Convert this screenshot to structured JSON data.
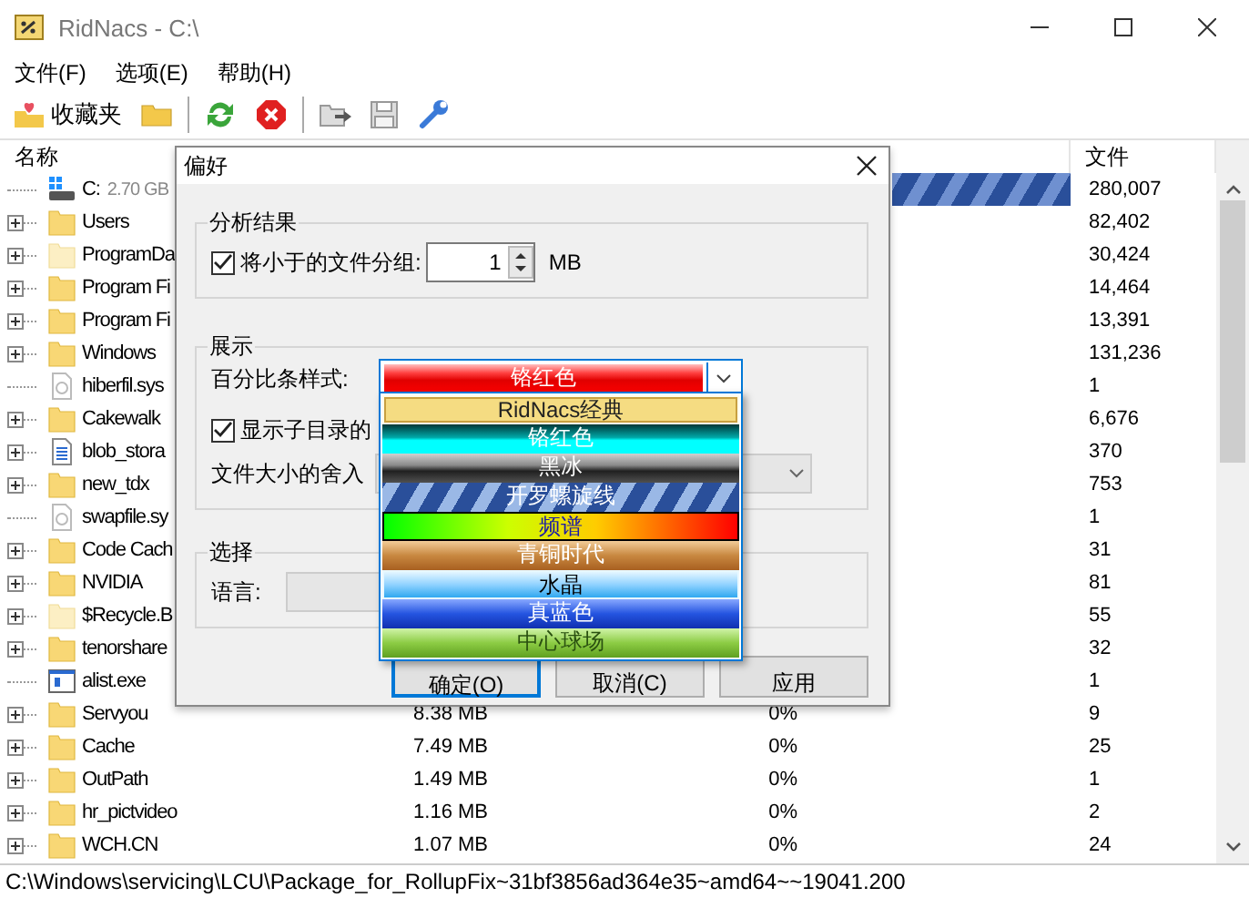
{
  "window": {
    "title": "RidNacs - C:\\"
  },
  "menu": [
    "文件(F)",
    "选项(E)",
    "帮助(H)"
  ],
  "toolbar": [
    {
      "kind": "favorites",
      "label": "收藏夹"
    },
    {
      "kind": "folder"
    },
    {
      "kind": "separator"
    },
    {
      "kind": "refresh"
    },
    {
      "kind": "stop"
    },
    {
      "kind": "separator"
    },
    {
      "kind": "export"
    },
    {
      "kind": "save"
    },
    {
      "kind": "settings"
    }
  ],
  "list": {
    "name_header": "名称",
    "files_header": "文件",
    "rows": [
      {
        "name": "C:",
        "detail": "2.70 GB",
        "kind": "drive",
        "expandable": false,
        "level": 1,
        "files": "280,007"
      },
      {
        "name": "Users",
        "kind": "folder",
        "expandable": true,
        "files": "82,402"
      },
      {
        "name": "ProgramDa",
        "kind": "faded_folder",
        "expandable": true,
        "files": "30,424"
      },
      {
        "name": "Program Fi",
        "kind": "folder",
        "expandable": true,
        "files": "14,464"
      },
      {
        "name": "Program Fi",
        "kind": "folder",
        "expandable": true,
        "files": "13,391"
      },
      {
        "name": "Windows",
        "kind": "folder",
        "expandable": true,
        "files": "131,236"
      },
      {
        "name": "hiberfil.sys",
        "kind": "system_file",
        "expandable": false,
        "files": "1"
      },
      {
        "name": "Cakewalk",
        "kind": "folder",
        "expandable": true,
        "files": "6,676"
      },
      {
        "name": "blob_stora",
        "kind": "document",
        "expandable": true,
        "files": "370"
      },
      {
        "name": "new_tdx",
        "kind": "folder",
        "expandable": true,
        "files": "753"
      },
      {
        "name": "swapfile.sy",
        "kind": "system_file",
        "expandable": false,
        "files": "1"
      },
      {
        "name": "Code Cach",
        "kind": "folder",
        "expandable": true,
        "files": "31"
      },
      {
        "name": "NVIDIA",
        "kind": "folder",
        "expandable": true,
        "files": "81"
      },
      {
        "name": "$Recycle.B",
        "kind": "faded_folder",
        "expandable": true,
        "files": "55"
      },
      {
        "name": "tenorshare",
        "kind": "folder",
        "expandable": true,
        "files": "32"
      },
      {
        "name": "alist.exe",
        "kind": "program",
        "expandable": false,
        "files": "1"
      },
      {
        "name": "Servyou",
        "kind": "folder",
        "expandable": true,
        "size": "8.38 MB",
        "percent": "0%",
        "files": "9"
      },
      {
        "name": "Cache",
        "kind": "folder",
        "expandable": true,
        "size": "7.49 MB",
        "percent": "0%",
        "files": "25"
      },
      {
        "name": "OutPath",
        "kind": "folder",
        "expandable": true,
        "size": "1.49 MB",
        "percent": "0%",
        "files": "1"
      },
      {
        "name": "hr_pictvideo",
        "kind": "folder",
        "expandable": true,
        "size": "1.16 MB",
        "percent": "0%",
        "files": "2"
      },
      {
        "name": "WCH.CN",
        "kind": "folder",
        "expandable": true,
        "size": "1.07 MB",
        "percent": "0%",
        "files": "24"
      }
    ]
  },
  "status_bar": "C:\\Windows\\servicing\\LCU\\Package_for_RollupFix~31bf3856ad364e35~amd64~~19041.200",
  "dialog": {
    "title": "偏好",
    "analysis": {
      "title": "分析结果",
      "group_small": {
        "label": "将小于的文件分组:",
        "checked": true
      },
      "threshold": "1",
      "unit": "MB"
    },
    "display": {
      "title": "展示",
      "bar_style_label": "百分比条样式:",
      "bar_style": {
        "value": "铬红色",
        "kind": "chrome_red"
      },
      "subdir": {
        "label": "显示子目录的",
        "checked": true
      },
      "rounding_label": "文件大小的舍入"
    },
    "selection": {
      "title": "选择",
      "language_label": "语言:"
    },
    "dropdown": [
      {
        "label": "RidNacs经典",
        "kind": "classic",
        "selected": true
      },
      {
        "label": "铬红色",
        "kind": "chrome_cyan",
        "selected": false
      },
      {
        "label": "黑冰",
        "kind": "black_ice",
        "selected": false
      },
      {
        "label": "开罗螺旋线",
        "kind": "cairo_spiral",
        "selected": false
      },
      {
        "label": "频谱",
        "kind": "spectrum",
        "selected": false
      },
      {
        "label": "青铜时代",
        "kind": "bronze",
        "selected": false
      },
      {
        "label": "水晶",
        "kind": "crystal",
        "selected": false
      },
      {
        "label": "真蓝色",
        "kind": "true_blue",
        "selected": false
      },
      {
        "label": "中心球场",
        "kind": "center_court",
        "selected": false
      }
    ],
    "buttons": [
      {
        "label": "确定(O)",
        "default": true
      },
      {
        "label": "取消(C)",
        "default": false
      },
      {
        "label": "应用",
        "default": false
      }
    ]
  }
}
